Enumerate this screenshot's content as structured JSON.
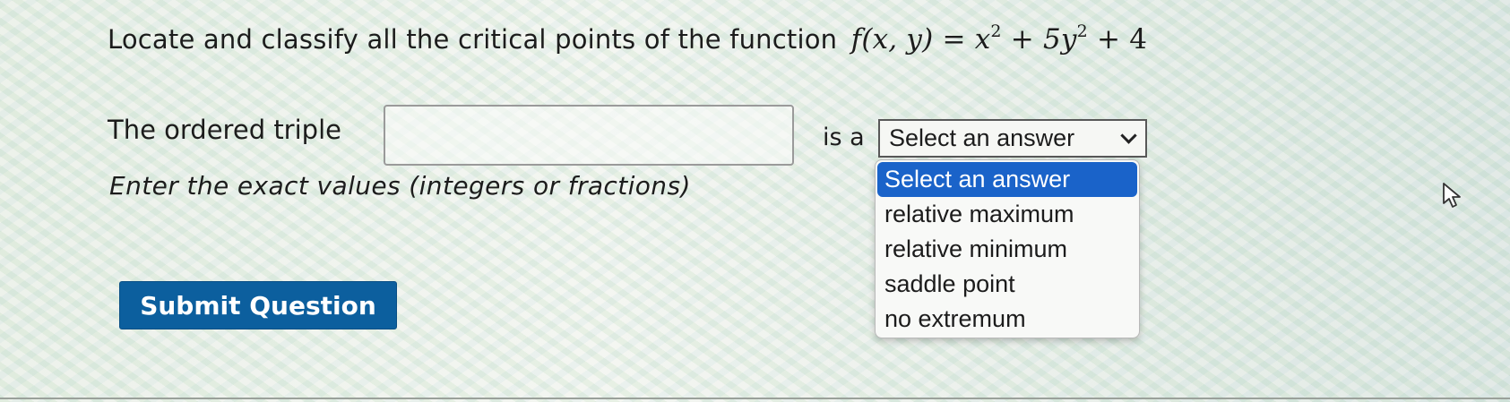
{
  "question": {
    "text": "Locate and classify all the critical points of the function",
    "function_prefix": "f(x, y) = x",
    "exp1": "2",
    "mid": " + 5y",
    "exp2": "2",
    "suffix": " + 4"
  },
  "answer_row": {
    "label": "The ordered triple",
    "input_value": "",
    "connector": "is a",
    "select_value": "Select an answer"
  },
  "hint": "Enter the exact values (integers or fractions)",
  "dropdown": {
    "options": [
      "Select an answer",
      "relative maximum",
      "relative minimum",
      "saddle point",
      "no extremum"
    ],
    "highlighted_index": 0
  },
  "submit": {
    "label": "Submit Question"
  },
  "colors": {
    "submit_bg": "#0c5f9e",
    "highlight": "#1a63c9",
    "text": "#1c1c1c"
  },
  "icons": {
    "select_chevron": "chevron-down-icon",
    "pointer": "mouse-pointer-icon"
  }
}
